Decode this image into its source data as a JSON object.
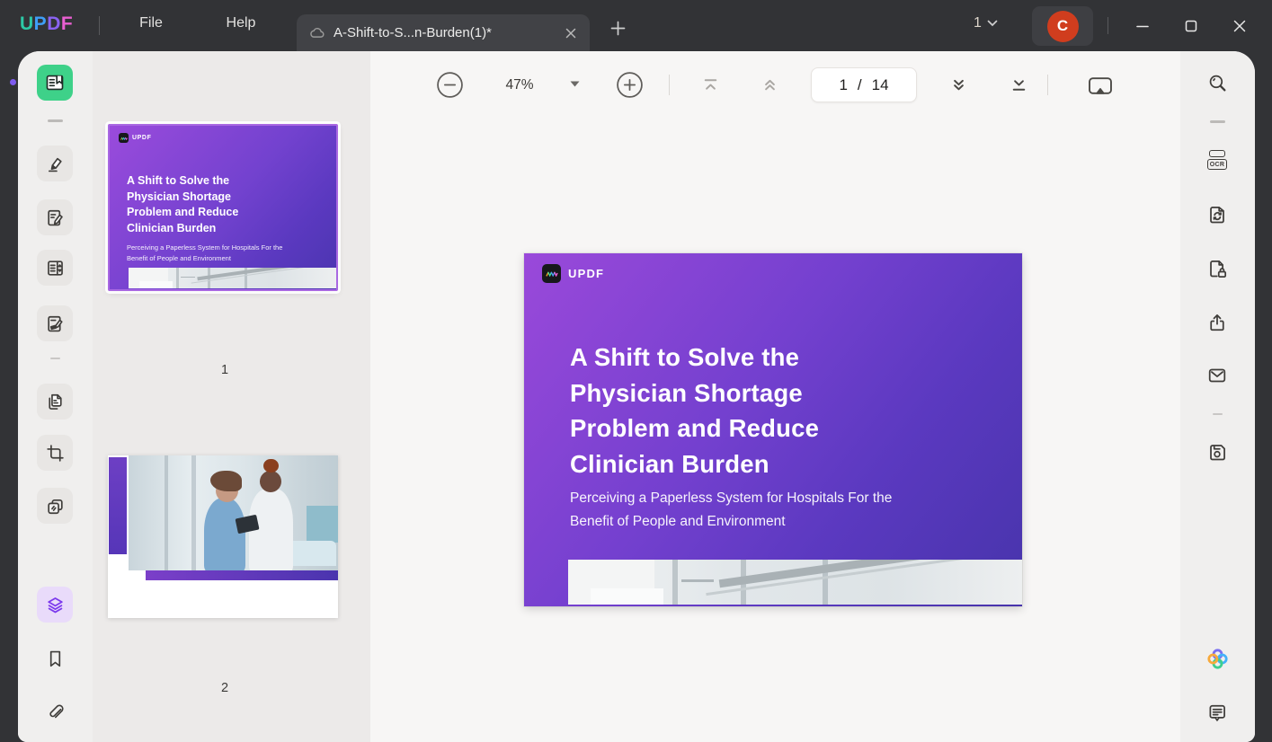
{
  "colors": {
    "titlebar_bg": "#323336",
    "accent_green": "#3ed189",
    "accent_purple": "#7c3aed",
    "thumb_selected_border": "#a968e2",
    "avatar_red": "#d03d1e",
    "page_gradient_start": "#9a49da",
    "page_gradient_end": "#4734ab"
  },
  "titlebar": {
    "brand_letters": [
      "U",
      "P",
      "D",
      "F"
    ],
    "menus": [
      {
        "label": "File"
      },
      {
        "label": "Help"
      }
    ],
    "tab_title": "A-Shift-to-S...n-Burden(1)*",
    "window_count": "1",
    "avatar_initial": "C"
  },
  "toolbar": {
    "zoom_level": "47%",
    "page_current": "1",
    "page_separator": "/",
    "page_total": "14"
  },
  "left_sidebar": {
    "items": [
      "reader",
      "highlighter",
      "edit-pdf",
      "organize-pages",
      "fill-sign",
      "page-tools",
      "crop",
      "watermark",
      "page-thumbnails",
      "bookmark",
      "attachment"
    ]
  },
  "right_sidebar": {
    "ocr_label": "OCR",
    "items": [
      "search",
      "ocr",
      "convert",
      "protect",
      "share",
      "email",
      "save",
      "ai-assistant",
      "feedback"
    ]
  },
  "thumbnails": {
    "pages": [
      {
        "label": "1",
        "logo_text": "UPDF",
        "title": "A Shift to Solve the Physician Shortage Problem and Reduce Clinician Burden",
        "subtitle": "Perceiving a Paperless System for Hospitals For the Benefit of People and Environment"
      },
      {
        "label": "2"
      }
    ]
  },
  "document": {
    "logo_text": "UPDF",
    "title": "A Shift to Solve the Physician Shortage Problem and Reduce Clinician Burden",
    "subtitle": "Perceiving a Paperless System for Hospitals For the Benefit of People and Environment"
  }
}
